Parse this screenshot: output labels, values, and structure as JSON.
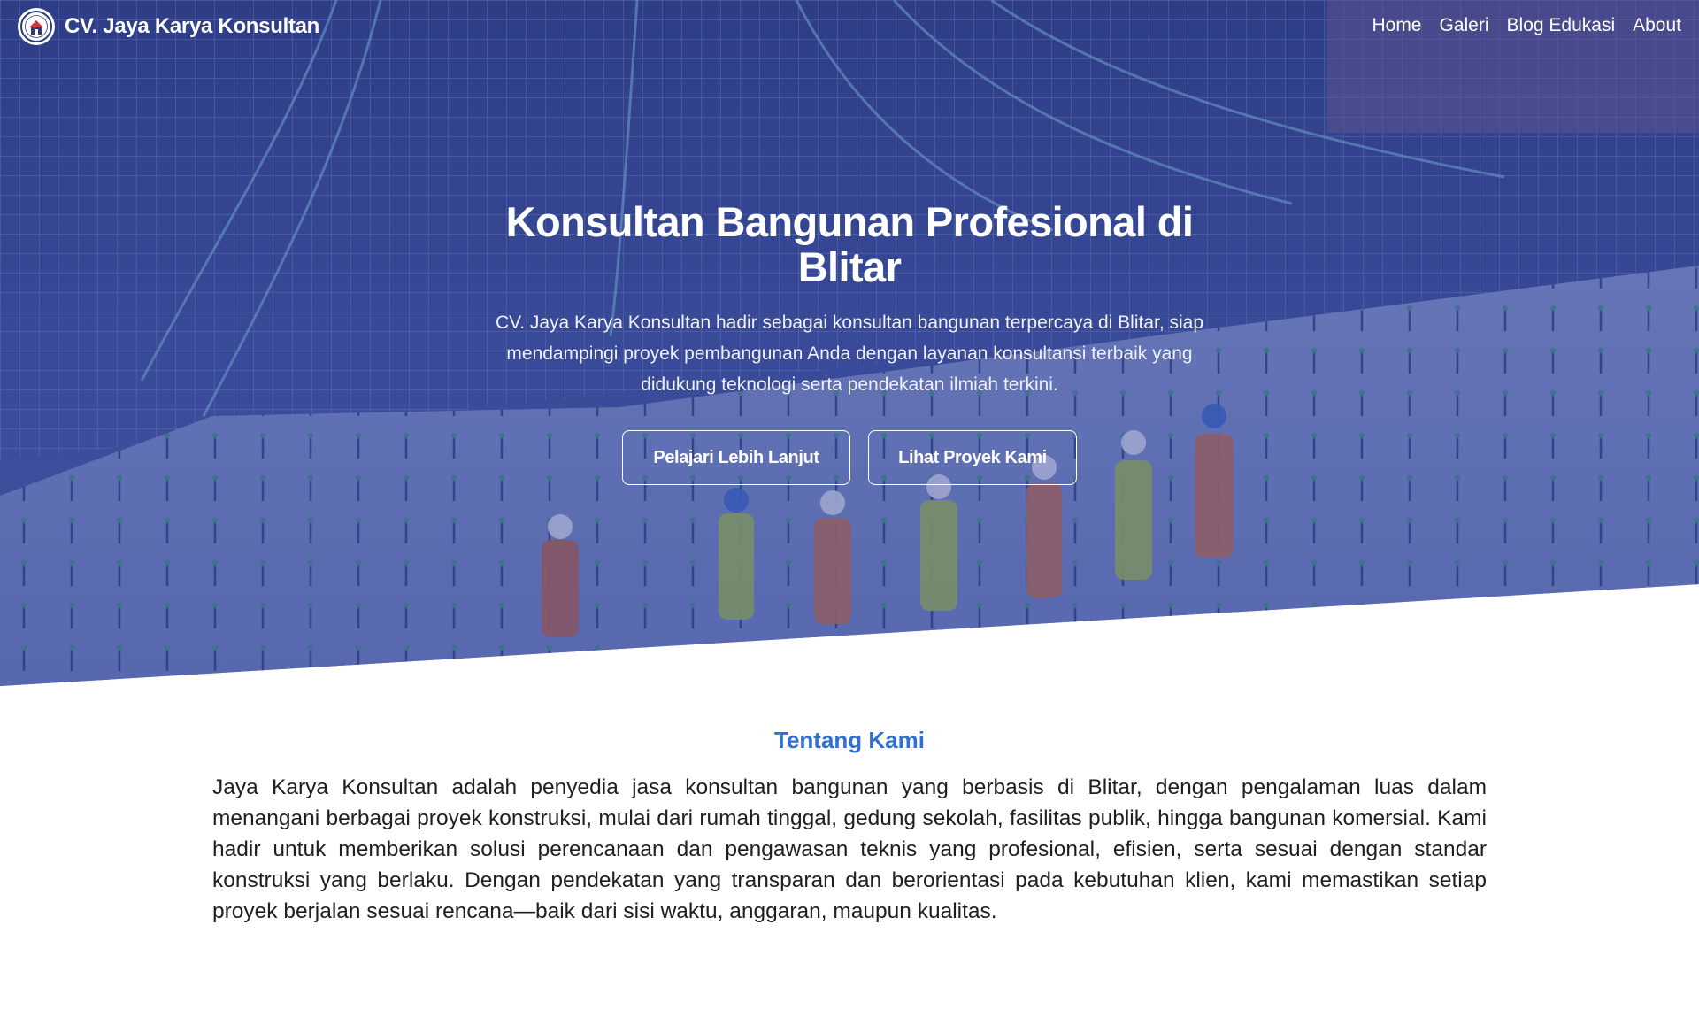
{
  "navbar": {
    "brand_name": "CV. Jaya Karya Konsultan",
    "links": [
      {
        "label": "Home"
      },
      {
        "label": "Galeri"
      },
      {
        "label": "Blog Edukasi"
      },
      {
        "label": "About"
      }
    ]
  },
  "hero": {
    "title": "Konsultan Bangunan Profesional di Blitar",
    "description": "CV. Jaya Karya Konsultan hadir sebagai konsultan bangunan terpercaya di Blitar, siap mendampingi proyek pembangunan Anda dengan layanan konsultansi terbaik yang didukung teknologi serta pendekatan ilmiah terkini.",
    "buttons": {
      "learn_more": "Pelajari Lebih Lanjut",
      "projects": "Lihat Proyek Kami"
    }
  },
  "about": {
    "heading": "Tentang Kami",
    "text": "Jaya Karya Konsultan adalah penyedia jasa konsultan bangunan yang berbasis di Blitar, dengan pengalaman luas dalam menangani berbagai proyek konstruksi, mulai dari rumah tinggal, gedung sekolah, fasilitas publik, hingga bangunan komersial. Kami hadir untuk memberikan solusi perencanaan dan pengawasan teknis yang profesional, efisien, serta sesuai dengan standar konstruksi yang berlaku. Dengan pendekatan yang transparan dan berorientasi pada kebutuhan klien, kami memastikan setiap proyek berjalan sesuai rencana—baik dari sisi waktu, anggaran, maupun kualitas."
  },
  "colors": {
    "hero_overlay": "#34479a",
    "accent": "#2f6fd6",
    "body_text": "#1f1f1f"
  },
  "icons": {
    "logo": "company-logo-house-icon"
  }
}
